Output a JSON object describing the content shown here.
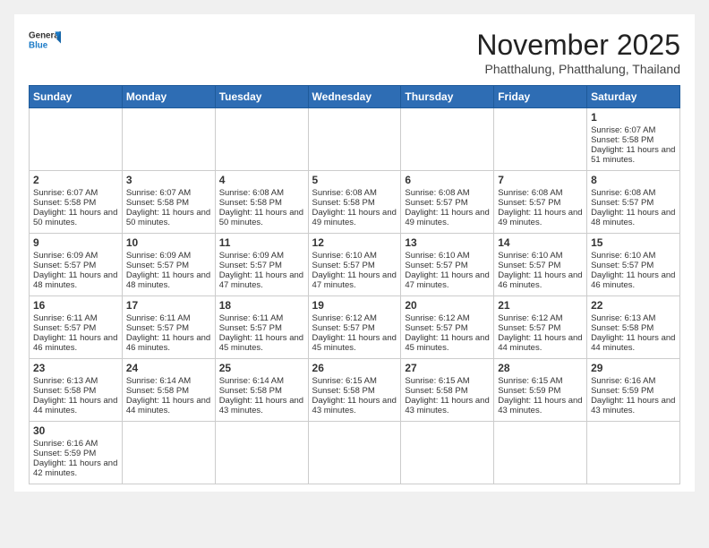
{
  "header": {
    "logo_general": "General",
    "logo_blue": "Blue",
    "month_title": "November 2025",
    "location": "Phatthalung, Phatthalung, Thailand"
  },
  "weekdays": [
    "Sunday",
    "Monday",
    "Tuesday",
    "Wednesday",
    "Thursday",
    "Friday",
    "Saturday"
  ],
  "weeks": [
    [
      {
        "day": "",
        "text": ""
      },
      {
        "day": "",
        "text": ""
      },
      {
        "day": "",
        "text": ""
      },
      {
        "day": "",
        "text": ""
      },
      {
        "day": "",
        "text": ""
      },
      {
        "day": "",
        "text": ""
      },
      {
        "day": "1",
        "text": "Sunrise: 6:07 AM\nSunset: 5:58 PM\nDaylight: 11 hours and 51 minutes."
      }
    ],
    [
      {
        "day": "2",
        "text": "Sunrise: 6:07 AM\nSunset: 5:58 PM\nDaylight: 11 hours and 50 minutes."
      },
      {
        "day": "3",
        "text": "Sunrise: 6:07 AM\nSunset: 5:58 PM\nDaylight: 11 hours and 50 minutes."
      },
      {
        "day": "4",
        "text": "Sunrise: 6:08 AM\nSunset: 5:58 PM\nDaylight: 11 hours and 50 minutes."
      },
      {
        "day": "5",
        "text": "Sunrise: 6:08 AM\nSunset: 5:58 PM\nDaylight: 11 hours and 49 minutes."
      },
      {
        "day": "6",
        "text": "Sunrise: 6:08 AM\nSunset: 5:57 PM\nDaylight: 11 hours and 49 minutes."
      },
      {
        "day": "7",
        "text": "Sunrise: 6:08 AM\nSunset: 5:57 PM\nDaylight: 11 hours and 49 minutes."
      },
      {
        "day": "8",
        "text": "Sunrise: 6:08 AM\nSunset: 5:57 PM\nDaylight: 11 hours and 48 minutes."
      }
    ],
    [
      {
        "day": "9",
        "text": "Sunrise: 6:09 AM\nSunset: 5:57 PM\nDaylight: 11 hours and 48 minutes."
      },
      {
        "day": "10",
        "text": "Sunrise: 6:09 AM\nSunset: 5:57 PM\nDaylight: 11 hours and 48 minutes."
      },
      {
        "day": "11",
        "text": "Sunrise: 6:09 AM\nSunset: 5:57 PM\nDaylight: 11 hours and 47 minutes."
      },
      {
        "day": "12",
        "text": "Sunrise: 6:10 AM\nSunset: 5:57 PM\nDaylight: 11 hours and 47 minutes."
      },
      {
        "day": "13",
        "text": "Sunrise: 6:10 AM\nSunset: 5:57 PM\nDaylight: 11 hours and 47 minutes."
      },
      {
        "day": "14",
        "text": "Sunrise: 6:10 AM\nSunset: 5:57 PM\nDaylight: 11 hours and 46 minutes."
      },
      {
        "day": "15",
        "text": "Sunrise: 6:10 AM\nSunset: 5:57 PM\nDaylight: 11 hours and 46 minutes."
      }
    ],
    [
      {
        "day": "16",
        "text": "Sunrise: 6:11 AM\nSunset: 5:57 PM\nDaylight: 11 hours and 46 minutes."
      },
      {
        "day": "17",
        "text": "Sunrise: 6:11 AM\nSunset: 5:57 PM\nDaylight: 11 hours and 46 minutes."
      },
      {
        "day": "18",
        "text": "Sunrise: 6:11 AM\nSunset: 5:57 PM\nDaylight: 11 hours and 45 minutes."
      },
      {
        "day": "19",
        "text": "Sunrise: 6:12 AM\nSunset: 5:57 PM\nDaylight: 11 hours and 45 minutes."
      },
      {
        "day": "20",
        "text": "Sunrise: 6:12 AM\nSunset: 5:57 PM\nDaylight: 11 hours and 45 minutes."
      },
      {
        "day": "21",
        "text": "Sunrise: 6:12 AM\nSunset: 5:57 PM\nDaylight: 11 hours and 44 minutes."
      },
      {
        "day": "22",
        "text": "Sunrise: 6:13 AM\nSunset: 5:58 PM\nDaylight: 11 hours and 44 minutes."
      }
    ],
    [
      {
        "day": "23",
        "text": "Sunrise: 6:13 AM\nSunset: 5:58 PM\nDaylight: 11 hours and 44 minutes."
      },
      {
        "day": "24",
        "text": "Sunrise: 6:14 AM\nSunset: 5:58 PM\nDaylight: 11 hours and 44 minutes."
      },
      {
        "day": "25",
        "text": "Sunrise: 6:14 AM\nSunset: 5:58 PM\nDaylight: 11 hours and 43 minutes."
      },
      {
        "day": "26",
        "text": "Sunrise: 6:15 AM\nSunset: 5:58 PM\nDaylight: 11 hours and 43 minutes."
      },
      {
        "day": "27",
        "text": "Sunrise: 6:15 AM\nSunset: 5:58 PM\nDaylight: 11 hours and 43 minutes."
      },
      {
        "day": "28",
        "text": "Sunrise: 6:15 AM\nSunset: 5:59 PM\nDaylight: 11 hours and 43 minutes."
      },
      {
        "day": "29",
        "text": "Sunrise: 6:16 AM\nSunset: 5:59 PM\nDaylight: 11 hours and 43 minutes."
      }
    ],
    [
      {
        "day": "30",
        "text": "Sunrise: 6:16 AM\nSunset: 5:59 PM\nDaylight: 11 hours and 42 minutes."
      },
      {
        "day": "",
        "text": ""
      },
      {
        "day": "",
        "text": ""
      },
      {
        "day": "",
        "text": ""
      },
      {
        "day": "",
        "text": ""
      },
      {
        "day": "",
        "text": ""
      },
      {
        "day": "",
        "text": ""
      }
    ]
  ]
}
